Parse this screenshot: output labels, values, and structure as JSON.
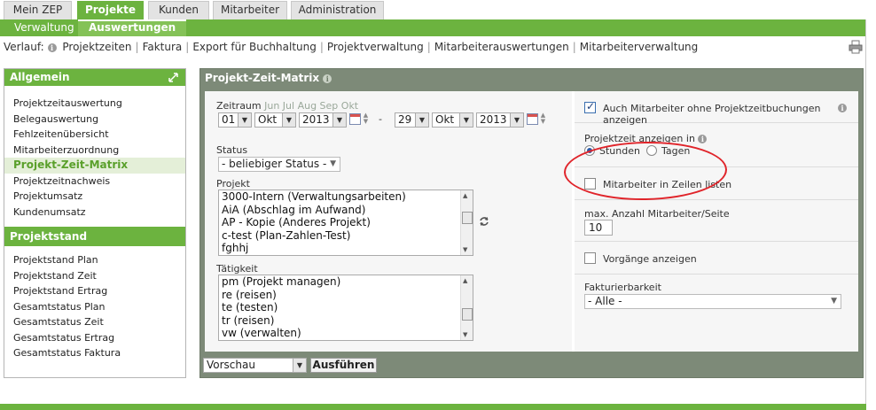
{
  "tabs": [
    {
      "label": "Mein ZEP"
    },
    {
      "label": "Projekte"
    },
    {
      "label": "Kunden"
    },
    {
      "label": "Mitarbeiter"
    },
    {
      "label": "Administration"
    }
  ],
  "subtabs": [
    {
      "label": "Verwaltung"
    },
    {
      "label": "Auswertungen"
    }
  ],
  "breadcrumb": {
    "label": "Verlauf:",
    "items": [
      "Projektzeiten",
      "Faktura",
      "Export für Buchhaltung",
      "Projektverwaltung",
      "Mitarbeiterauswertungen",
      "Mitarbeiterverwaltung"
    ]
  },
  "sidebar": {
    "section1": {
      "title": "Allgemein",
      "items": [
        "Projektzeitauswertung",
        "Belegauswertung",
        "Fehlzeitenübersicht",
        "Mitarbeiterzuordnung",
        "Projekt-Zeit-Matrix",
        "Projektzeitnachweis",
        "Projektumsatz",
        "Kundenumsatz"
      ]
    },
    "section2": {
      "title": "Projektstand",
      "items": [
        "Projektstand Plan",
        "Projektstand Zeit",
        "Projektstand Ertrag",
        "Gesamtstatus Plan",
        "Gesamtstatus Zeit",
        "Gesamtstatus Ertrag",
        "Gesamtstatus Faktura"
      ]
    }
  },
  "panel": {
    "title": "Projekt-Zeit-Matrix",
    "zeitraum": {
      "label": "Zeitraum",
      "shortcuts": "Jun Jul Aug Sep Okt",
      "from_day": "01",
      "from_month": "Okt",
      "from_year": "2013",
      "dash": "-",
      "to_day": "29",
      "to_month": "Okt",
      "to_year": "2013"
    },
    "status": {
      "label": "Status",
      "value": "- beliebiger Status -"
    },
    "projekt": {
      "label": "Projekt",
      "options": [
        "3000-Intern (Verwaltungsarbeiten)",
        "AiA (Abschlag im Aufwand)",
        "AP - Kopie (Anderes Projekt)",
        "c-test (Plan-Zahlen-Test)",
        "fghhj"
      ]
    },
    "taetigkeit": {
      "label": "Tätigkeit",
      "options": [
        "pm (Projekt managen)",
        "re (reisen)",
        "te (testen)",
        "tr (reisen)",
        "vw (verwalten)"
      ]
    },
    "auch_mitarbeiter": {
      "label": "Auch Mitarbeiter ohne Projektzeitbuchungen anzeigen",
      "checked": true
    },
    "projektzeit": {
      "label": "Projektzeit anzeigen in",
      "options": [
        "Stunden",
        "Tagen"
      ],
      "selected": "Stunden"
    },
    "mitarbeiter_zeilen": {
      "label": "Mitarbeiter in Zeilen listen",
      "checked": false
    },
    "max_anzahl": {
      "label": "max. Anzahl Mitarbeiter/Seite",
      "value": "10"
    },
    "vorgaenge": {
      "label": "Vorgänge anzeigen",
      "checked": false
    },
    "fakturierbarkeit": {
      "label": "Fakturierbarkeit",
      "value": "- Alle -"
    },
    "output": {
      "value": "Vorschau"
    },
    "run_label": "Ausführen"
  },
  "colors": {
    "green": "#6cb33f",
    "panel": "#7d8a78",
    "highlight": "#e0242a"
  }
}
